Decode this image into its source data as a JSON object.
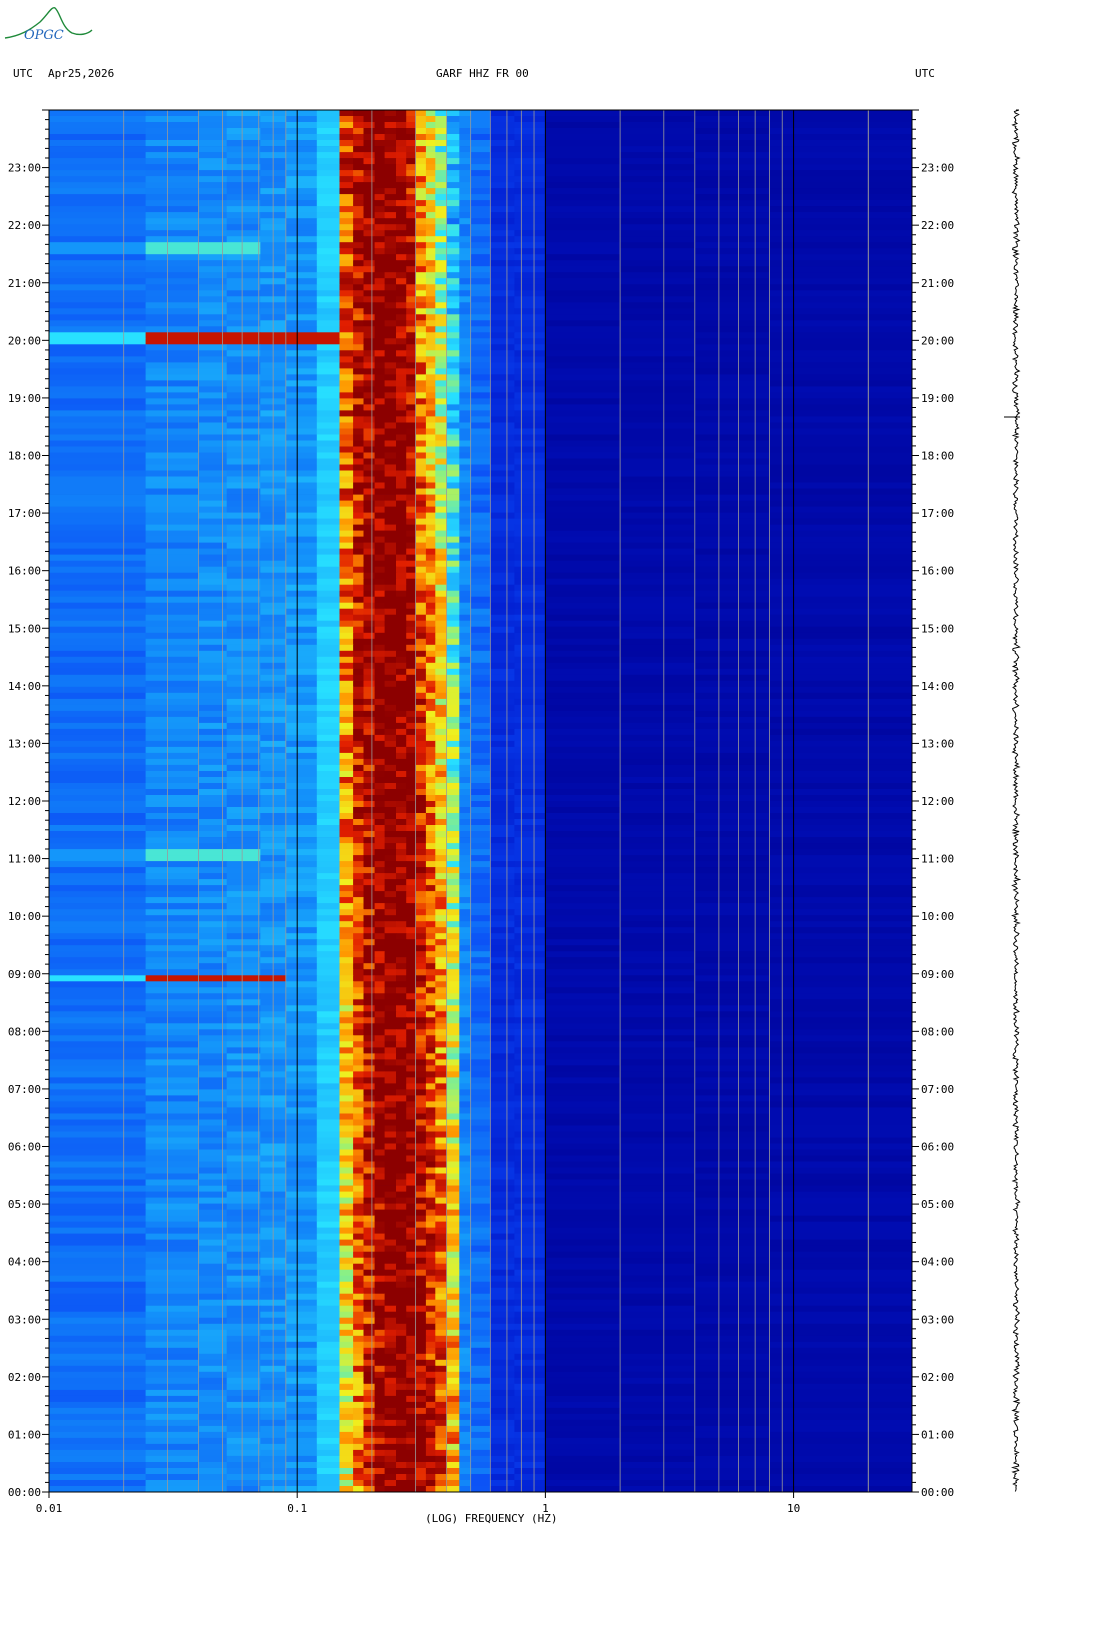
{
  "header": {
    "utc_left": "UTC",
    "date": "Apr25,2026",
    "station": "GARF HHZ FR 00",
    "utc_right": "UTC"
  },
  "logo": {
    "text": "OPGC",
    "color": "#1f8a3a"
  },
  "colors": {
    "background_low": "#00008f",
    "mid_blue": "#0a3ad8",
    "cyan": "#20e0ff",
    "yellow": "#f0f020",
    "red": "#e01000",
    "dark_red": "#900000"
  },
  "chart_data": {
    "type": "heatmap",
    "xlabel": "(LOG) FREQUENCY (HZ)",
    "x_scale": "log",
    "xlim": [
      0.01,
      30
    ],
    "x_tick_labels": [
      "0.01",
      "0.1",
      "1",
      "10"
    ],
    "x_ticks": [
      0.01,
      0.1,
      1,
      10
    ],
    "y_scale": "time",
    "ylim_hours": [
      0,
      24
    ],
    "y_tick_labels": [
      "00:00",
      "01:00",
      "02:00",
      "03:00",
      "04:00",
      "05:00",
      "06:00",
      "07:00",
      "08:00",
      "09:00",
      "10:00",
      "11:00",
      "12:00",
      "13:00",
      "14:00",
      "15:00",
      "16:00",
      "17:00",
      "18:00",
      "19:00",
      "20:00",
      "21:00",
      "22:00",
      "23:00"
    ],
    "microseism_band_hz": [
      0.15,
      0.45
    ],
    "events": [
      {
        "time": "20:00",
        "fmax_hz": 0.15,
        "strength": "strong"
      },
      {
        "time": "21:35",
        "fmax_hz": 0.07,
        "strength": "weak"
      },
      {
        "time": "11:05",
        "fmax_hz": 0.07,
        "strength": "weak"
      },
      {
        "time": "08:55",
        "fmax_hz": 0.09,
        "strength": "strong"
      }
    ]
  }
}
